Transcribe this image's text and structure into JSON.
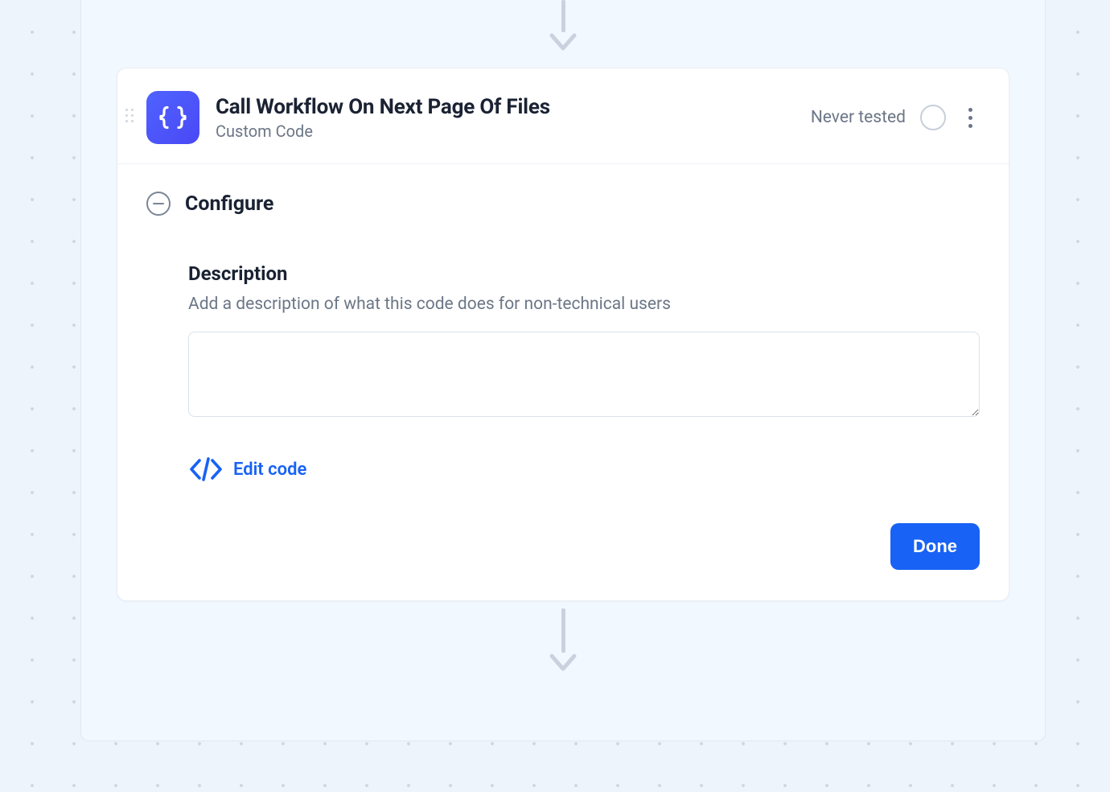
{
  "node": {
    "title": "Call Workflow On Next Page Of Files",
    "subtitle": "Custom Code",
    "status_text": "Never tested",
    "icon_name": "code-braces-icon"
  },
  "section": {
    "title": "Configure"
  },
  "description": {
    "label": "Description",
    "help": "Add a description of what this code does for non-technical users",
    "value": ""
  },
  "actions": {
    "edit_code": "Edit code",
    "done": "Done"
  }
}
